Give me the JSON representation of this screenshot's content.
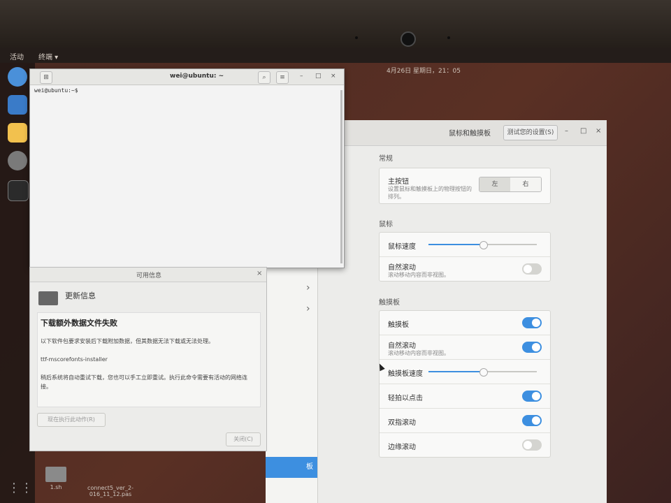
{
  "topbar": {
    "activities": "活动",
    "app_menu": "终端 ▾",
    "clock": "4月26日 星期日，21：05"
  },
  "dock": {
    "items": [
      {
        "icon": "chromium-icon",
        "color": "#4a90d9"
      },
      {
        "icon": "files-icon",
        "color": "#3a7bc8"
      },
      {
        "icon": "text-editor-icon",
        "color": "#f2c14e"
      },
      {
        "icon": "settings-icon",
        "color": "#7a7a7a"
      },
      {
        "icon": "terminal-icon",
        "color": "#2b2b2b"
      }
    ],
    "apps_grid": "⋮⋮"
  },
  "terminal": {
    "title": "wei@ubuntu: ~",
    "prompt": "wei@ubuntu:~$",
    "search_icon": "🔍",
    "menu_icon": "≡",
    "min": "–",
    "max": "□",
    "close": "×"
  },
  "settings": {
    "title": "鼠标和触摸板",
    "test_button": "测试您的设置(S)",
    "min": "–",
    "max": "□",
    "close": "×",
    "sections": {
      "general": "常规",
      "mouse": "鼠标",
      "touchpad": "触摸板"
    },
    "primary_button": {
      "label": "主按钮",
      "desc": "设置鼠标和触摸板上的物理按钮的排列。",
      "left": "左",
      "right": "右"
    },
    "mouse_speed": {
      "label": "鼠标速度",
      "level": 0.5
    },
    "mouse_natural_scroll": {
      "label": "自然滚动",
      "desc": "滚动移动内容而非视图。",
      "enabled": false
    },
    "touchpad": {
      "label": "触摸板",
      "enabled": true
    },
    "touchpad_natural_scroll": {
      "label": "自然滚动",
      "desc": "滚动移动内容而非视图。",
      "enabled": true
    },
    "touchpad_speed": {
      "label": "触摸板速度",
      "level": 0.5
    },
    "tap_to_click": {
      "label": "轻拍以点击",
      "enabled": true
    },
    "two_finger_scroll": {
      "label": "双指滚动",
      "enabled": true
    },
    "edge_scroll": {
      "label": "边缘滚动",
      "enabled": false
    },
    "sidebar_selected_tail": "板"
  },
  "dialog": {
    "title": "可用信息",
    "close": "×",
    "app_title": "更新信息",
    "heading": "下载额外数据文件失败",
    "line1": "以下软件包要求安装后下载附加数据，但其数据无法下载或无法处理。",
    "package": "ttf-mscorefonts-installer",
    "line2": "稍后系统将自动重试下载，您也可以手工立即重试。执行此命令需要有活动的网络连接。",
    "run_button": "现在执行此动作(R)",
    "close_button": "关闭(C)"
  },
  "desktop": {
    "file1": "1.sh",
    "file2": "connect5_ver_2-016_11_12.pas"
  }
}
